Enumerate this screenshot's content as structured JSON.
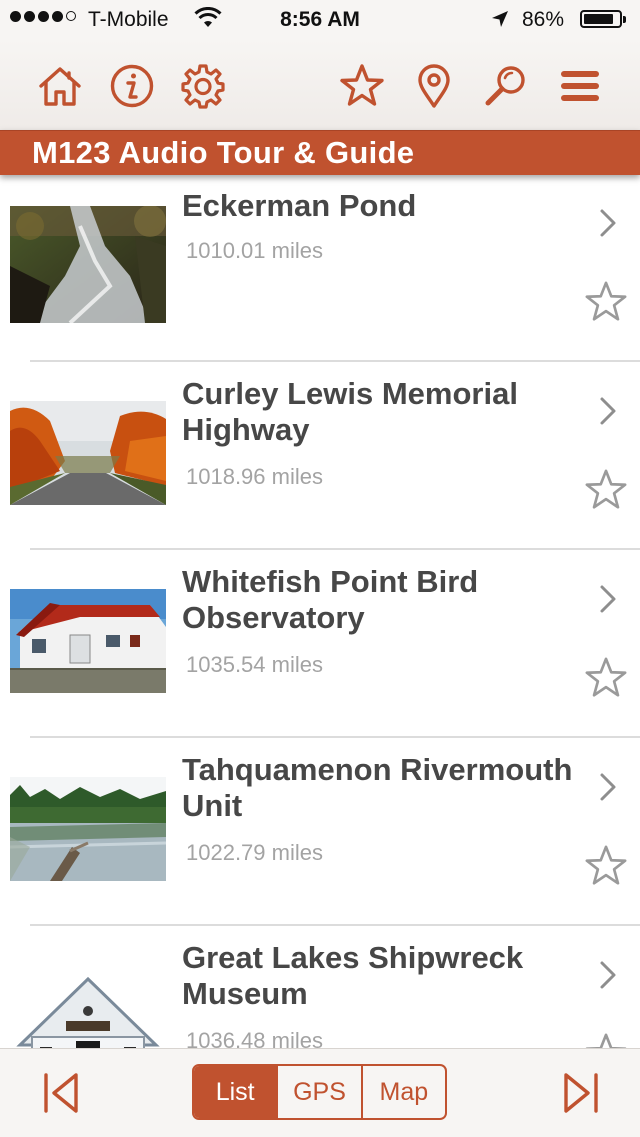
{
  "status_bar": {
    "carrier": "T-Mobile",
    "time": "8:56 AM",
    "battery": "86%",
    "battery_level": 0.86
  },
  "toolbar": {
    "buttons": [
      "home-icon",
      "info-icon",
      "gear-icon",
      "star-icon",
      "location-pin-icon",
      "search-icon",
      "menu-icon"
    ]
  },
  "header": {
    "title": "M123 Audio Tour & Guide"
  },
  "stops": [
    {
      "name": "Eckerman Pond",
      "distance": "1010.01 miles"
    },
    {
      "name": "Curley Lewis Memorial Highway",
      "distance": "1018.96 miles"
    },
    {
      "name": "Whitefish Point Bird Observatory",
      "distance": "1035.54 miles"
    },
    {
      "name": "Tahquamenon Rivermouth Unit",
      "distance": "1022.79 miles"
    },
    {
      "name": "Great Lakes Shipwreck Museum",
      "distance": "1036.48 miles"
    }
  ],
  "bottom_bar": {
    "tabs": [
      "List",
      "GPS",
      "Map"
    ],
    "active_tab": "List"
  },
  "colors": {
    "accent": "#c0522f",
    "background": "#ffffff",
    "bar": "#f7f5f3"
  }
}
